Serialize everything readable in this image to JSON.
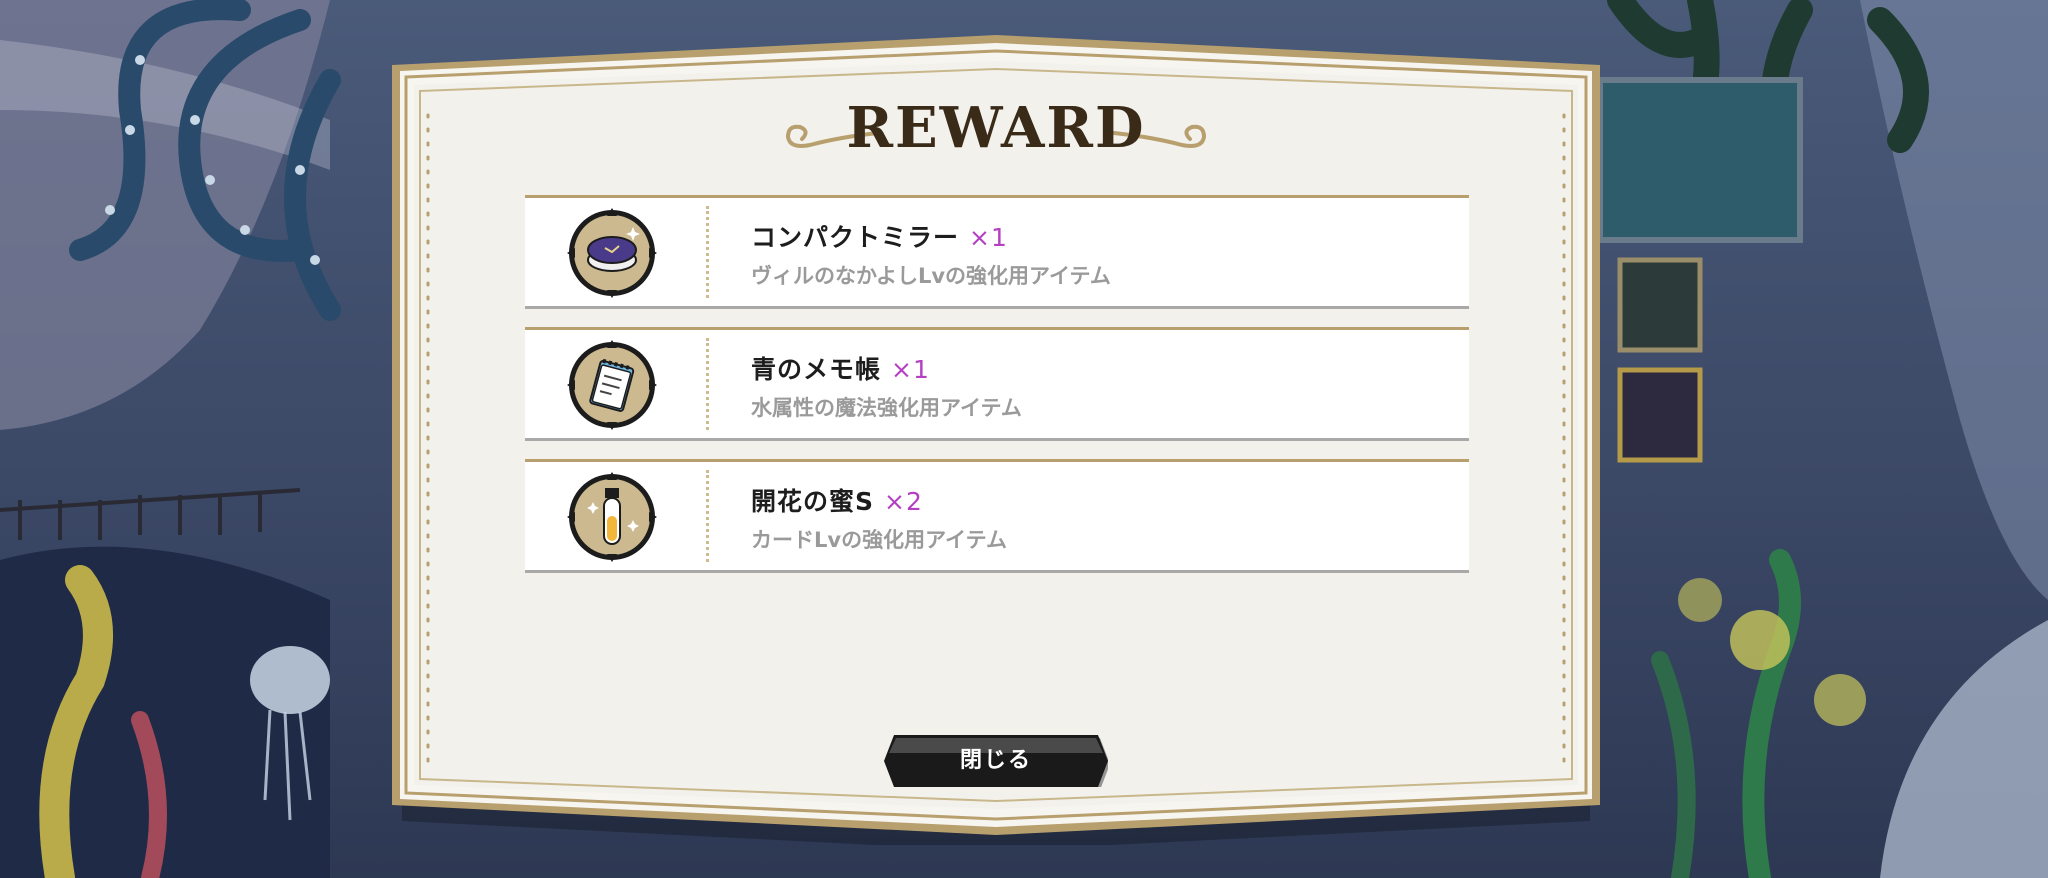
{
  "dialog": {
    "title": "REWARD",
    "close_label": "閉じる"
  },
  "rewards": [
    {
      "name": "コンパクトミラー",
      "quantity": "×1",
      "description": "ヴィルのなかよしLvの強化用アイテム",
      "icon": "compact-mirror-icon"
    },
    {
      "name": "青のメモ帳",
      "quantity": "×1",
      "description": "水属性の魔法強化用アイテム",
      "icon": "blue-notebook-icon"
    },
    {
      "name": "開花の蜜S",
      "quantity": "×2",
      "description": "カードLvの強化用アイテム",
      "icon": "bloom-nectar-vial-icon"
    }
  ],
  "colors": {
    "frame_gold": "#b79f6e",
    "panel_bg": "#f3f1ec",
    "quantity_accent": "#b43fc2",
    "button_bg": "#1a1a1a"
  }
}
